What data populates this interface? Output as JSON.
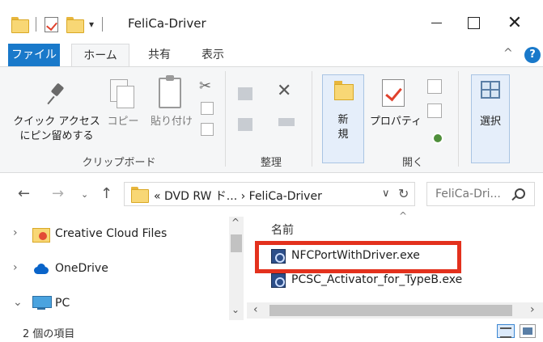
{
  "window": {
    "title": "FeliCa-Driver",
    "close_glyph": "✕"
  },
  "qat": {
    "dropdown_glyph": "▾"
  },
  "ribbon_tabs": {
    "file": "ファイル",
    "home": "ホーム",
    "share": "共有",
    "view": "表示",
    "collapse_glyph": "^",
    "help_glyph": "?"
  },
  "ribbon": {
    "quick_access_line1": "クイック アクセス",
    "quick_access_line2": "にピン留めする",
    "copy": "コピー",
    "paste": "貼り付け",
    "clipboard_group": "クリップボード",
    "organize_group": "整理",
    "delete_glyph": "✕",
    "new_line1": "新",
    "new_line2": "規",
    "properties": "プロパティ",
    "open_group": "開く",
    "select": "選択",
    "scissors_glyph": "✂"
  },
  "address": {
    "back_glyph": "←",
    "forward_glyph": "→",
    "history_glyph": "⌄",
    "up_glyph": "↑",
    "path": "« DVD RW ド... › FeliCa-Driver",
    "chevron_glyph": "∨",
    "refresh_glyph": "↻",
    "search_placeholder": "FeliCa-Dri..."
  },
  "nav_pane": {
    "items": [
      {
        "label": "Creative Cloud Files",
        "chevron": "›",
        "icon": "creative-cloud-folder-icon"
      },
      {
        "label": "OneDrive",
        "chevron": "›",
        "icon": "onedrive-cloud-icon"
      },
      {
        "label": "PC",
        "chevron": "⌄",
        "icon": "pc-icon"
      }
    ],
    "scroll_up_glyph": "^",
    "scroll_down_glyph": "⌄"
  },
  "file_pane": {
    "sort_glyph": "^",
    "column_name": "名前",
    "files": [
      {
        "name": "NFCPortWithDriver.exe",
        "highlighted": true
      },
      {
        "name": "PCSC_Activator_for_TypeB.exe",
        "highlighted": false
      }
    ],
    "scroll_left_glyph": "‹",
    "scroll_right_glyph": "›"
  },
  "status": {
    "item_count": "2 個の項目"
  },
  "colors": {
    "accent": "#1979ca",
    "highlight": "#e3311d",
    "folder": "#f8d775"
  }
}
